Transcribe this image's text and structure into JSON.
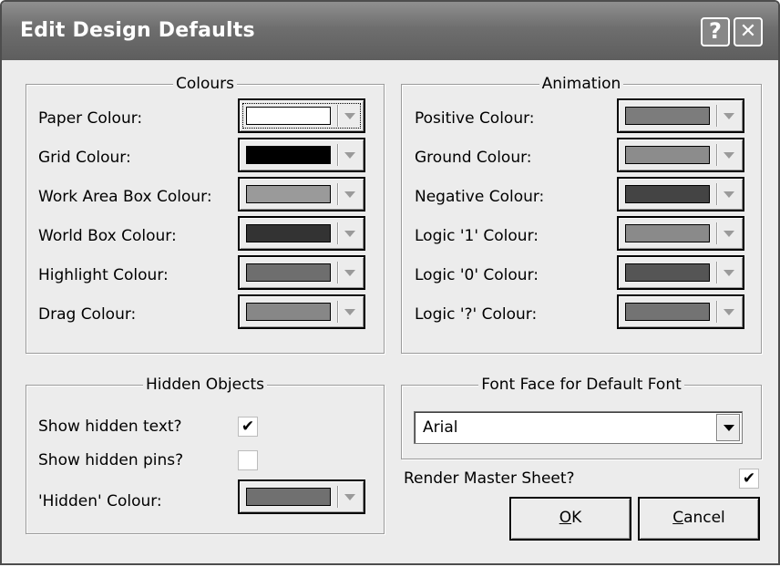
{
  "window": {
    "title": "Edit Design Defaults",
    "help_glyph": "?",
    "close_glyph": "✕"
  },
  "colours": {
    "legend": "Colours",
    "items": [
      {
        "label": "Paper Colour:",
        "color": "#ffffff"
      },
      {
        "label": "Grid Colour:",
        "color": "#000000"
      },
      {
        "label": "Work Area Box Colour:",
        "color": "#9a9a9a"
      },
      {
        "label": "World Box Colour:",
        "color": "#333333"
      },
      {
        "label": "Highlight Colour:",
        "color": "#6e6e6e"
      },
      {
        "label": "Drag Colour:",
        "color": "#878787"
      }
    ]
  },
  "animation": {
    "legend": "Animation",
    "items": [
      {
        "label": "Positive Colour:",
        "color": "#7c7c7c"
      },
      {
        "label": "Ground Colour:",
        "color": "#8c8c8c"
      },
      {
        "label": "Negative Colour:",
        "color": "#444444"
      },
      {
        "label": "Logic '1' Colour:",
        "color": "#8a8a8a"
      },
      {
        "label": "Logic '0' Colour:",
        "color": "#555555"
      },
      {
        "label": "Logic '?' Colour:",
        "color": "#737373"
      }
    ]
  },
  "hidden_objects": {
    "legend": "Hidden Objects",
    "show_hidden_text": {
      "label": "Show hidden text?",
      "checked": true
    },
    "show_hidden_pins": {
      "label": "Show hidden pins?",
      "checked": false
    },
    "hidden_colour": {
      "label": "'Hidden' Colour:",
      "color": "#707070"
    }
  },
  "font_face": {
    "legend": "Font Face for Default Font",
    "value": "Arial"
  },
  "render_master_sheet": {
    "label": "Render Master Sheet?",
    "checked": true
  },
  "buttons": {
    "ok": {
      "mnemonic": "O",
      "rest": "K"
    },
    "cancel": {
      "mnemonic": "C",
      "rest": "ancel"
    }
  }
}
